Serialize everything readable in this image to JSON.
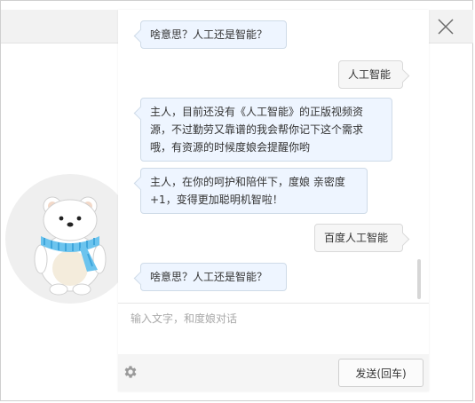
{
  "colors": {
    "bot_bubble": "#eef5ff",
    "user_bubble": "#f6f6f6",
    "scarf": "#6cc4ee"
  },
  "messages": [
    {
      "sender": "bot",
      "text": "啥意思？人工还是智能？"
    },
    {
      "sender": "user",
      "text": "人工智能"
    },
    {
      "sender": "bot",
      "text": "主人，目前还没有《人工智能》的正版视频资\n源，不过勤劳又靠谱的我会帮你记下这个需求\n哦，有资源的时候度娘会提醒你哟"
    },
    {
      "sender": "bot",
      "text": "主人，在你的呵护和陪伴下，度娘 亲密度\n+1，变得更加聪明机智啦！"
    },
    {
      "sender": "user",
      "text": "百度人工智能"
    },
    {
      "sender": "bot",
      "text": "啥意思？人工还是智能？"
    }
  ],
  "input": {
    "placeholder": "输入文字，和度娘对话",
    "value": ""
  },
  "send_button": {
    "label": "发送(回车)"
  },
  "icons": {
    "close": "close-icon",
    "settings": "gear-icon",
    "avatar": "polar-bear-avatar"
  }
}
